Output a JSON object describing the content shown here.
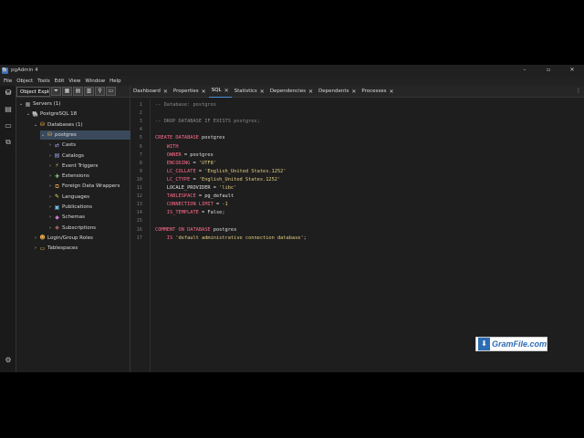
{
  "window": {
    "title": "pgAdmin 4",
    "app_icon": "elephant-icon"
  },
  "window_buttons": {
    "minimize": "–",
    "maximize": "▫",
    "close": "✕"
  },
  "menu": [
    "File",
    "Object",
    "Tools",
    "Edit",
    "View",
    "Window",
    "Help"
  ],
  "explorer": {
    "tab_label": "Object Explorer",
    "toolbar": [
      "filter-icon",
      "table-icon",
      "grid-icon",
      "view-icon",
      "search-icon",
      "terminal-icon"
    ],
    "tree": [
      {
        "label": "Servers (1)",
        "level": 0,
        "expanded": true,
        "icon": "server-group-icon",
        "selected": false
      },
      {
        "label": "PostgreSQL 18",
        "level": 1,
        "expanded": true,
        "icon": "postgres-server-icon",
        "selected": false
      },
      {
        "label": "Databases (1)",
        "level": 2,
        "expanded": true,
        "icon": "databases-icon",
        "selected": false
      },
      {
        "label": "postgres",
        "level": 3,
        "expanded": true,
        "icon": "database-icon",
        "selected": true
      },
      {
        "label": "Casts",
        "level": 4,
        "expanded": false,
        "icon": "casts-icon",
        "selected": false
      },
      {
        "label": "Catalogs",
        "level": 4,
        "expanded": false,
        "icon": "catalogs-icon",
        "selected": false
      },
      {
        "label": "Event Triggers",
        "level": 4,
        "expanded": false,
        "icon": "event-triggers-icon",
        "selected": false
      },
      {
        "label": "Extensions",
        "level": 4,
        "expanded": false,
        "icon": "extensions-icon",
        "selected": false
      },
      {
        "label": "Foreign Data Wrappers",
        "level": 4,
        "expanded": false,
        "icon": "fdw-icon",
        "selected": false
      },
      {
        "label": "Languages",
        "level": 4,
        "expanded": false,
        "icon": "languages-icon",
        "selected": false
      },
      {
        "label": "Publications",
        "level": 4,
        "expanded": false,
        "icon": "publications-icon",
        "selected": false
      },
      {
        "label": "Schemas",
        "level": 4,
        "expanded": false,
        "icon": "schemas-icon",
        "selected": false
      },
      {
        "label": "Subscriptions",
        "level": 4,
        "expanded": false,
        "icon": "subscriptions-icon",
        "selected": false
      },
      {
        "label": "Login/Group Roles",
        "level": 2,
        "expanded": false,
        "icon": "roles-icon",
        "selected": false
      },
      {
        "label": "Tablespaces",
        "level": 2,
        "expanded": false,
        "icon": "tablespaces-icon",
        "selected": false
      }
    ]
  },
  "tabs": [
    {
      "label": "Dashboard",
      "active": false
    },
    {
      "label": "Properties",
      "active": false
    },
    {
      "label": "SQL",
      "active": true
    },
    {
      "label": "Statistics",
      "active": false
    },
    {
      "label": "Dependencies",
      "active": false
    },
    {
      "label": "Dependents",
      "active": false
    },
    {
      "label": "Processes",
      "active": false
    }
  ],
  "code_lines": [
    [
      [
        "c-com",
        "-- Database: postgres"
      ]
    ],
    [],
    [
      [
        "c-com",
        "-- DROP DATABASE IF EXISTS postgres;"
      ]
    ],
    [],
    [
      [
        "c-kw",
        "CREATE DATABASE"
      ],
      [
        "c-plain",
        " postgres"
      ]
    ],
    [
      [
        "c-kw",
        "    WITH"
      ]
    ],
    [
      [
        "c-kw",
        "    OWNER"
      ],
      [
        "c-plain",
        " = postgres"
      ]
    ],
    [
      [
        "c-kw",
        "    ENCODING"
      ],
      [
        "c-plain",
        " = "
      ],
      [
        "c-str",
        "'UTF8'"
      ]
    ],
    [
      [
        "c-kw",
        "    LC_COLLATE"
      ],
      [
        "c-plain",
        " = "
      ],
      [
        "c-str",
        "'English_United States.1252'"
      ]
    ],
    [
      [
        "c-kw",
        "    LC_CTYPE"
      ],
      [
        "c-plain",
        " = "
      ],
      [
        "c-str",
        "'English_United States.1252'"
      ]
    ],
    [
      [
        "c-plain",
        "    LOCALE_PROVIDER = "
      ],
      [
        "c-str",
        "'libc'"
      ]
    ],
    [
      [
        "c-kw",
        "    TABLESPACE"
      ],
      [
        "c-plain",
        " = pg_default"
      ]
    ],
    [
      [
        "c-kw",
        "    CONNECTION LIMIT"
      ],
      [
        "c-plain",
        " = "
      ],
      [
        "c-num",
        "-1"
      ]
    ],
    [
      [
        "c-kw",
        "    IS_TEMPLATE"
      ],
      [
        "c-plain",
        " = False;"
      ]
    ],
    [],
    [
      [
        "c-kw",
        "COMMENT ON DATABASE"
      ],
      [
        "c-plain",
        " postgres"
      ]
    ],
    [
      [
        "c-kw",
        "    IS"
      ],
      [
        "c-plain",
        " "
      ],
      [
        "c-str",
        "'default administrative connection database'"
      ],
      [
        "c-plain",
        ";"
      ]
    ]
  ],
  "watermark": {
    "text": "GramFile.com",
    "icon": "download-icon"
  },
  "colors": {
    "keyword": "#ff6b8a",
    "string": "#e6d080",
    "comment": "#8a8a8a",
    "selected": "#3a4a5c",
    "accent": "#4a90d9"
  }
}
